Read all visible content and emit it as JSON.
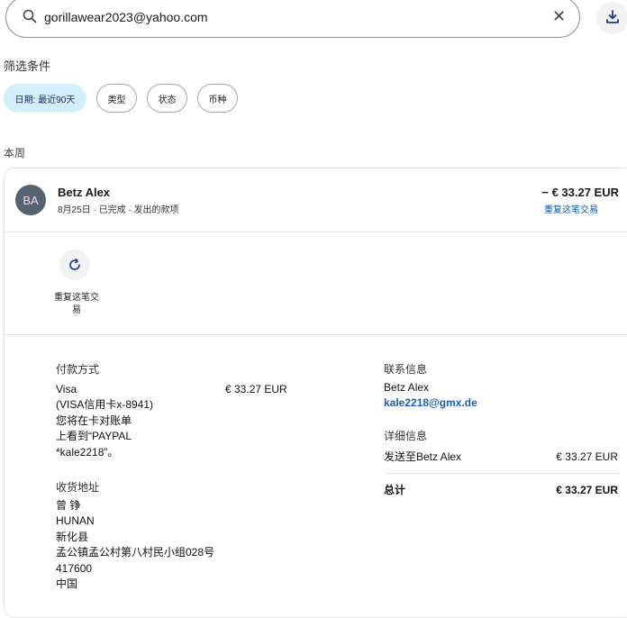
{
  "search": {
    "query": "gorillawear2023@yahoo.com"
  },
  "filters": {
    "title": "筛选条件",
    "chips": [
      "日期: 最近90天",
      "类型",
      "状态",
      "币种"
    ]
  },
  "section": {
    "title": "本周"
  },
  "transaction": {
    "initials": "BA",
    "name": "Betz Alex",
    "subtitle": "8月25日 · 已完成 · 发出的款项",
    "amount": "− € 33.27 EUR",
    "repeat_link": "重复这笔交易",
    "repeat_action_label": "重复这笔交易"
  },
  "payment": {
    "label": "付款方式",
    "lines": [
      "Visa",
      "(VISA信用卡x-8941)",
      "您将在卡对账单",
      "上看到“PAYPAL",
      "*kale2218”。"
    ],
    "amount": "€ 33.27 EUR"
  },
  "shipping": {
    "label": "收货地址",
    "lines": [
      "曾 铮",
      "HUNAN",
      "新化县",
      "孟公镇孟公村第八村民小组028号",
      "417600",
      "中国"
    ]
  },
  "contact": {
    "label": "联系信息",
    "name": "Betz Alex",
    "email": "kale2218@gmx.de"
  },
  "details": {
    "label": "详细信息",
    "sent_to": "发送至Betz Alex",
    "sent_amount": "€ 33.27 EUR",
    "total_label": "总计",
    "total_amount": "€ 33.27 EUR"
  }
}
